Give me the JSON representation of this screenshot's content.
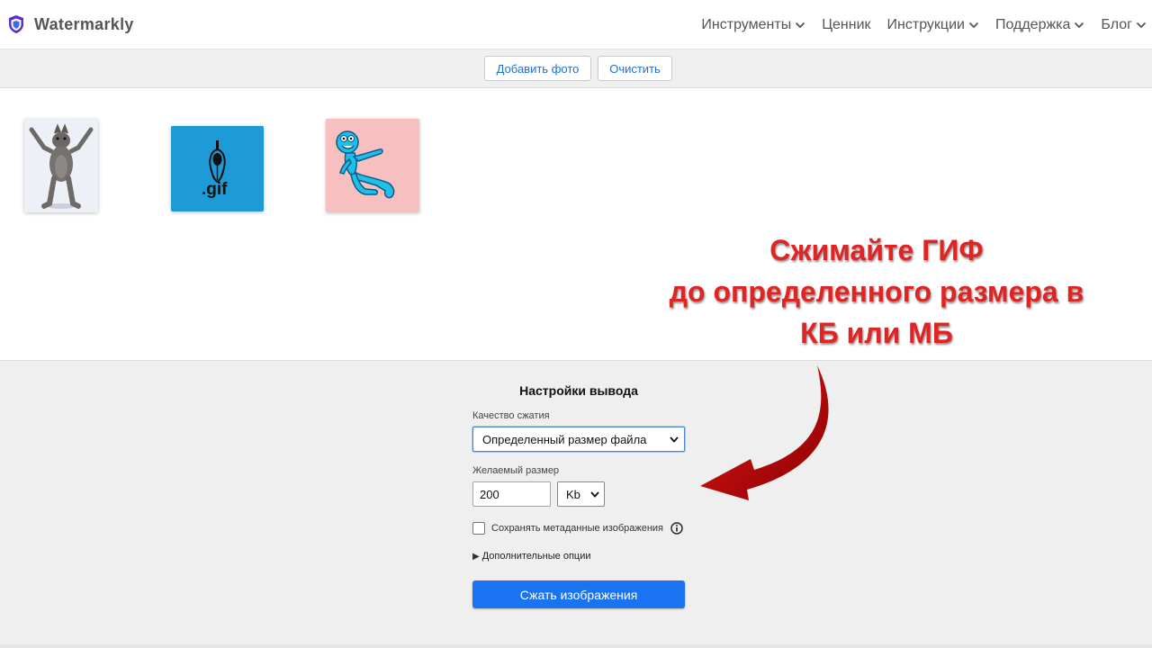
{
  "header": {
    "brand": "Watermarkly",
    "nav": [
      {
        "label": "Инструменты",
        "has_dropdown": true
      },
      {
        "label": "Ценник",
        "has_dropdown": false
      },
      {
        "label": "Инструкции",
        "has_dropdown": true
      },
      {
        "label": "Поддержка",
        "has_dropdown": true
      },
      {
        "label": "Блог",
        "has_dropdown": true
      }
    ]
  },
  "toolbar": {
    "add_label": "Добавить фото",
    "clear_label": "Очистить"
  },
  "gallery": {
    "gif_label": ".gif"
  },
  "promo": {
    "line1": "Сжимайте ГИФ",
    "line2": "до определенного размера в",
    "line3": "КБ или МБ",
    "color": "#e02424"
  },
  "settings": {
    "title": "Настройки вывода",
    "quality_label": "Качество сжатия",
    "quality_value": "Определенный размер файла",
    "size_label": "Желаемый размер",
    "size_value": "200",
    "unit_value": "Kb",
    "metadata_label": "Сохранять метаданные изображения",
    "metadata_checked": false,
    "more_options_label": "Дополнительные опции",
    "submit_label": "Сжать изображения"
  },
  "colors": {
    "primary": "#1a73f0",
    "link": "#1f6fd6",
    "arrow": "#b00000"
  }
}
